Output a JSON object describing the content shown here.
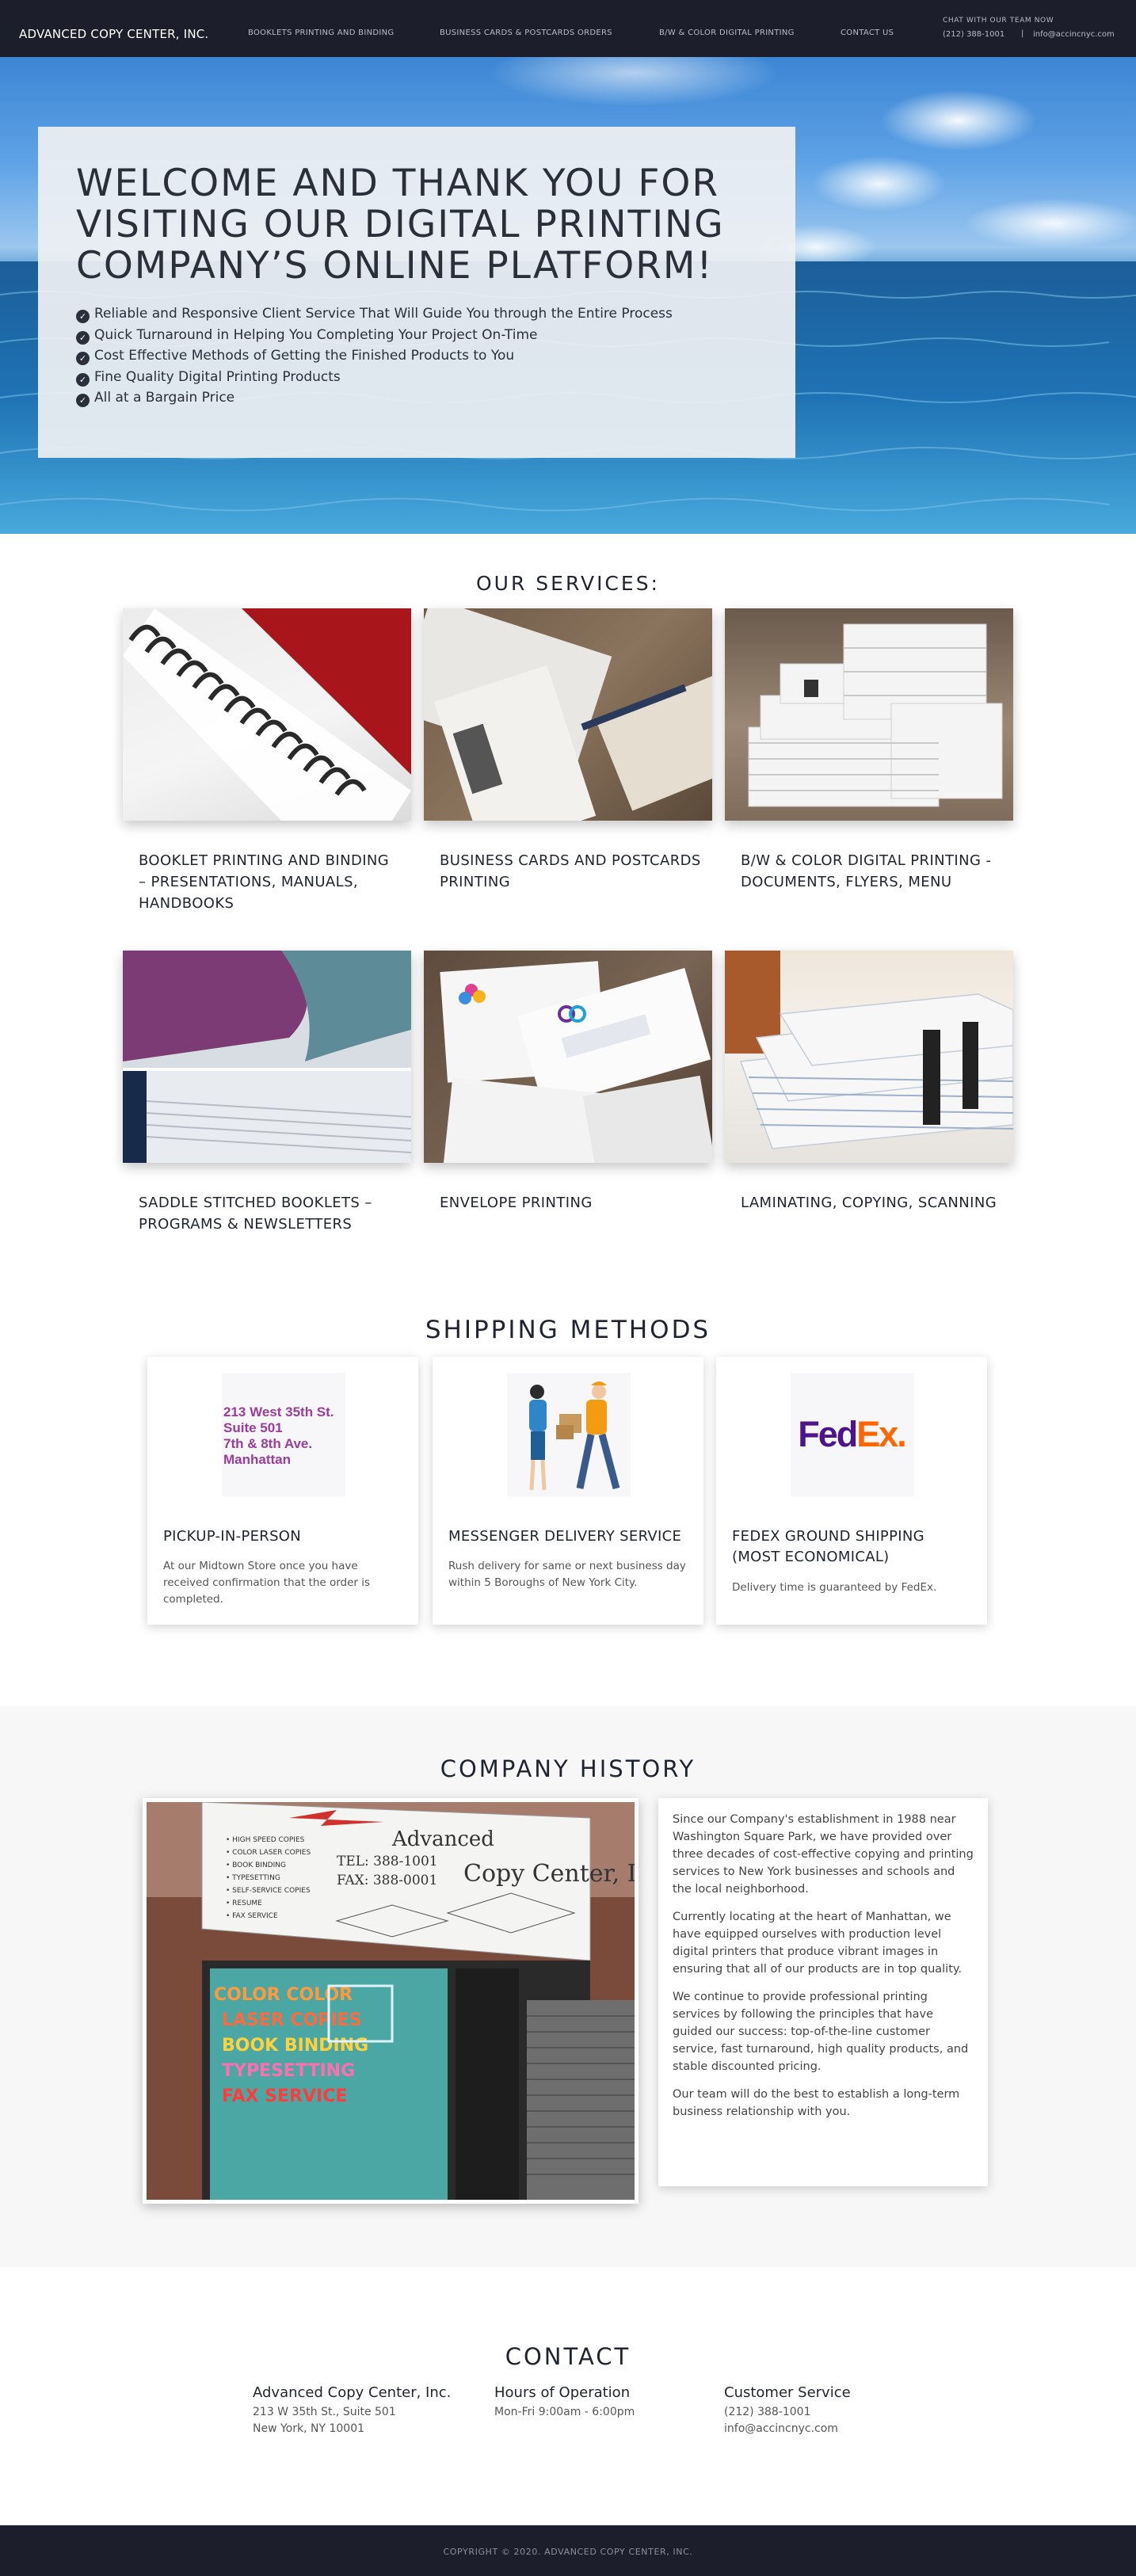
{
  "nav": {
    "brand": "ADVANCED COPY CENTER, INC.",
    "links": [
      "BOOKLETS PRINTING AND BINDING",
      "BUSINESS CARDS & POSTCARDS ORDERS",
      "B/W & COLOR DIGITAL PRINTING",
      "CONTACT US"
    ],
    "chat_label": "CHAT WITH OUR TEAM NOW",
    "phone": "(212) 388-1001",
    "separator": "|",
    "email": "info@accincnyc.com"
  },
  "hero": {
    "title": "WELCOME AND THANK YOU FOR VISITING OUR DIGITAL PRINTING COMPANY’S ONLINE PLATFORM!",
    "bullets": [
      "Reliable and Responsive Client Service That Will Guide You through the Entire Process",
      "Quick Turnaround in Helping You Completing Your Project On-Time",
      "Cost Effective Methods of Getting the Finished Products to You",
      "Fine Quality Digital Printing Products",
      "All at a Bargain Price"
    ]
  },
  "services": {
    "heading": "OUR SERVICES:",
    "items": [
      {
        "title": "BOOKLET PRINTING AND BINDING – PRESENTATIONS, MANUALS, HANDBOOKS"
      },
      {
        "title": "BUSINESS CARDS AND POSTCARDS PRINTING"
      },
      {
        "title": "B/W & COLOR DIGITAL PRINTING - DOCUMENTS, FLYERS, MENU"
      },
      {
        "title": "SADDLE STITCHED BOOKLETS – PROGRAMS & NEWSLETTERS"
      },
      {
        "title": "ENVELOPE PRINTING"
      },
      {
        "title": "LAMINATING, COPYING, SCANNING"
      }
    ]
  },
  "shipping": {
    "heading": "SHIPPING METHODS",
    "pickup_logo_lines": [
      "213 West 35th St.",
      "Suite 501",
      "7th & 8th Ave.",
      "Manhattan"
    ],
    "fedex_logo": {
      "fed": "Fed",
      "ex": "Ex",
      "dot": "."
    },
    "items": [
      {
        "title": "PICKUP-IN-PERSON",
        "text": "At our Midtown Store once you have received confirmation that the order is completed."
      },
      {
        "title": "MESSENGER DELIVERY SERVICE",
        "text": "Rush delivery for same or next business day within 5 Boroughs of New York City."
      },
      {
        "title": "FEDEX GROUND SHIPPING (MOST ECONOMICAL)",
        "text": "Delivery time is guaranteed by FedEx."
      }
    ]
  },
  "history": {
    "heading": "COMPANY HISTORY",
    "paragraphs": [
      "Since our Company's establishment in 1988 near Washington Square Park, we have provided over three decades of cost-effective copying and printing services to New York businesses and schools and the local neighborhood.",
      "Currently locating at the heart of Manhattan, we have equipped ourselves with production level digital printers that produce vibrant images in ensuring that all of our products are in top quality.",
      "We continue to provide professional printing services by following the principles that have guided our success: top-of-the-line customer service, fast turnaround, high quality products, and stable discounted pricing.",
      "Our team will do the best to establish a long-term business relationship with you."
    ]
  },
  "contact": {
    "heading": "CONTACT",
    "columns": [
      {
        "title": "Advanced Copy Center, Inc.",
        "lines": [
          "213 W 35th St., Suite 501",
          "New York, NY 10001"
        ]
      },
      {
        "title": "Hours of Operation",
        "lines": [
          "Mon-Fri 9:00am - 6:00pm"
        ]
      },
      {
        "title": "Customer Service",
        "lines": [
          "(212) 388-1001",
          "info@accincnyc.com"
        ]
      }
    ]
  },
  "footer": {
    "copyright": "COPYRIGHT © 2020. ADVANCED COPY CENTER, INC."
  },
  "colors": {
    "nav_bg": "#1d1e2c",
    "fedex_purple": "#4d148c",
    "fedex_orange": "#ff6600",
    "pickup_text": "#9b3c9e"
  }
}
